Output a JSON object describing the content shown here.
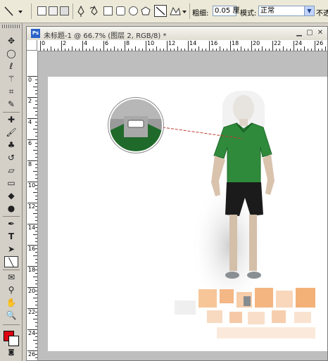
{
  "options_bar": {
    "width_label": "粗细:",
    "width_value": "0.05 厘",
    "mode_label": "模式:",
    "mode_value": "正常",
    "opacity_label": "不透"
  },
  "document": {
    "title": "未标题-1 @ 66.7% (图层 2, RGB/8) *",
    "app_icon": "Ps"
  },
  "rulers": {
    "horizontal": [
      "0",
      "2",
      "4",
      "6",
      "8",
      "10",
      "12",
      "14",
      "16",
      "18",
      "20",
      "22",
      "24",
      "26"
    ],
    "vertical": [
      "0",
      "2",
      "4",
      "6",
      "8",
      "10",
      "12",
      "14",
      "16",
      "18",
      "20",
      "22",
      "24",
      "26"
    ]
  },
  "canvas": {
    "shirt_color": "#2f8a3c",
    "pants_color": "#1b1b1b",
    "annotation_line_color": "#c0392b"
  },
  "tool_icons": [
    "move-icon",
    "ellipse-marquee-icon",
    "lasso-icon",
    "magic-wand-icon",
    "crop-icon",
    "eyedropper-icon",
    "healing-brush-icon",
    "brush-icon",
    "clone-stamp-icon",
    "history-brush-icon",
    "eraser-icon",
    "gradient-icon",
    "blur-icon",
    "dodge-icon",
    "pen-icon",
    "type-icon",
    "path-select-icon",
    "line-icon",
    "notes-icon",
    "eyedropper-sample-icon",
    "hand-icon",
    "zoom-icon"
  ]
}
